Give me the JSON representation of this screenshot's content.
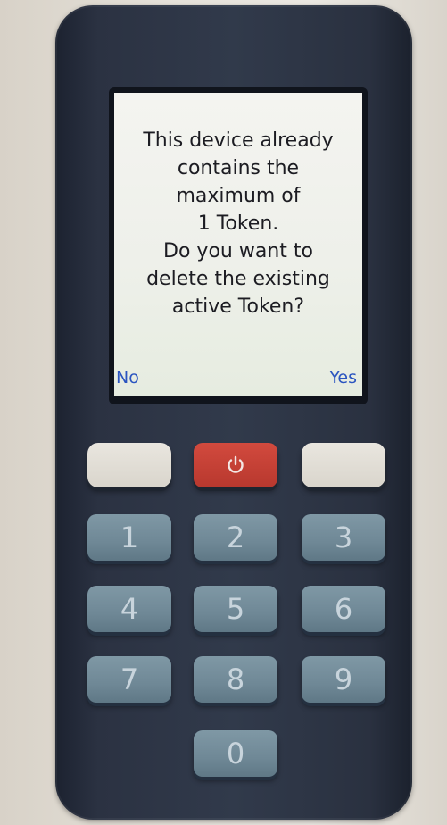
{
  "screen": {
    "message_lines": [
      "This device already",
      "contains the",
      "maximum of",
      "1 Token.",
      "Do you want to",
      "delete the existing",
      "active Token?"
    ],
    "soft_left_label": "No",
    "soft_right_label": "Yes"
  },
  "keypad": {
    "power_icon": "power-icon",
    "keys": [
      "1",
      "2",
      "3",
      "4",
      "5",
      "6",
      "7",
      "8",
      "9",
      "0"
    ]
  },
  "colors": {
    "device_body": "#2b3242",
    "screen_text": "#1c1c22",
    "softkey_label": "#2a54c0",
    "power_button": "#c8443a",
    "number_keys": "#6f8896"
  }
}
